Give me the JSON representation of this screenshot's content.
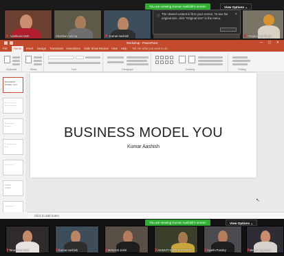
{
  "top_bar": {
    "share_banner": "You are viewing Kumar Aashish's screen",
    "view_options": "View Options ⌄"
  },
  "top_participants": [
    {
      "name": "Vaishnavi Seth"
    },
    {
      "name": "Shubham Verma"
    },
    {
      "name": "Kumar Aashish"
    },
    {
      "name": ""
    },
    {
      "name": "Gagandeep Singh"
    }
  ],
  "toast": {
    "icon": "info-icon",
    "message": "The shared content is fit to your screen. To see the original size, click \"Original size\" in the menu."
  },
  "powerpoint": {
    "title": "Workshop - PowerPoint",
    "tabs": [
      "File",
      "Home",
      "Insert",
      "Design",
      "Transitions",
      "Animations",
      "Slide Show",
      "Review",
      "View",
      "Help",
      "Tell me what you want to do"
    ],
    "ribbon_groups": [
      "Clipboard",
      "Slides",
      "Font",
      "Paragraph",
      "Drawing",
      "Editing"
    ],
    "slide": {
      "title": "BUSINESS MODEL YOU",
      "subtitle": "Kumar Aashish"
    },
    "notes_placeholder": "Click to add notes"
  },
  "bottom_bar": {
    "share_banner": "You are viewing Kumar Aashish's screen",
    "view_options": "View Options ⌄"
  },
  "bottom_participants": [
    {
      "name": "Tanushree Seth"
    },
    {
      "name": "Kumar Aashish"
    },
    {
      "name": "MANASI Joshi"
    },
    {
      "name": "AKSHAT KUMAR PATERIA"
    },
    {
      "name": "Ayushi Pandey"
    },
    {
      "name": "Megan Aggarwal"
    }
  ]
}
